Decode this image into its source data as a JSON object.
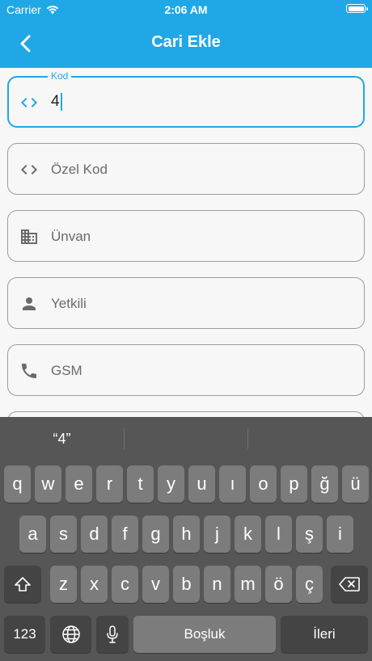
{
  "status_bar": {
    "carrier": "Carrier",
    "time": "2:06 AM",
    "battery_level": 1.0
  },
  "nav": {
    "title": "Cari Ekle",
    "back_icon": "chevron-left-icon"
  },
  "form": {
    "fields": [
      {
        "label": "Kod",
        "value": "4",
        "icon": "code-icon",
        "active": true
      },
      {
        "placeholder": "Özel Kod",
        "icon": "code-icon"
      },
      {
        "placeholder": "Ünvan",
        "icon": "building-icon"
      },
      {
        "placeholder": "Yetkili",
        "icon": "person-icon"
      },
      {
        "placeholder": "GSM",
        "icon": "phone-icon"
      }
    ]
  },
  "keyboard": {
    "suggestions": [
      "“4”",
      "",
      ""
    ],
    "row1": [
      "q",
      "w",
      "e",
      "r",
      "t",
      "y",
      "u",
      "ı",
      "o",
      "p",
      "ğ",
      "ü"
    ],
    "row2": [
      "a",
      "s",
      "d",
      "f",
      "g",
      "h",
      "j",
      "k",
      "l",
      "ş",
      "i"
    ],
    "row3": [
      "z",
      "x",
      "c",
      "v",
      "b",
      "n",
      "m",
      "ö",
      "ç"
    ],
    "numbers_label": "123",
    "space_label": "Boşluk",
    "return_label": "İleri",
    "colors": {
      "accent": "#20a7e6",
      "keyboard_bg": "#565656",
      "key_bg": "#7c7c7c",
      "key_dark": "#444444"
    }
  }
}
